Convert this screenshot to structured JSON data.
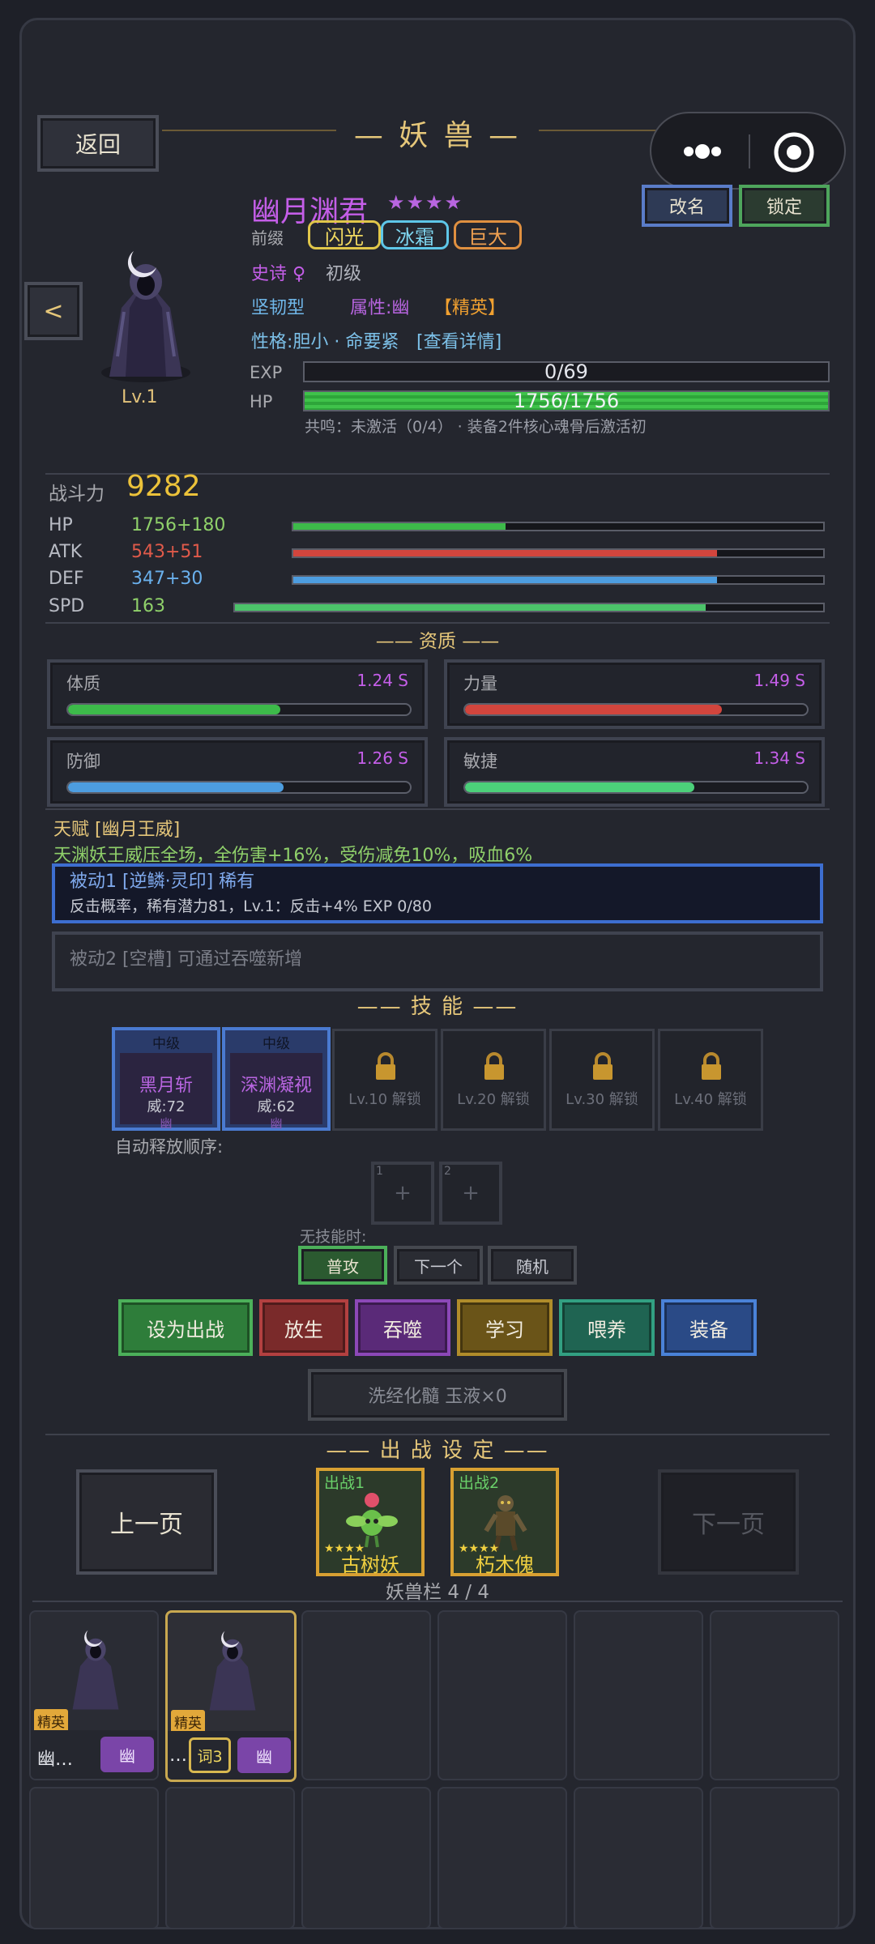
{
  "header": {
    "title": "— 妖 兽 —",
    "back_label": "返回",
    "rename_label": "改名",
    "lock_label": "锁定"
  },
  "monster": {
    "name": "幽月渊君",
    "stars": "★★★★",
    "prefix_label": "前缀",
    "prefixes": [
      "闪光",
      "冰霜",
      "巨大"
    ],
    "rarity": "史诗 ♀",
    "stage": "初级",
    "type": "坚韧型",
    "attribute": "属性:幽",
    "elite_tag": "【精英】",
    "personality": "性格:胆小 · 命要紧",
    "detail_link": "[查看详情]",
    "level": "Lv.1",
    "exp_label": "EXP",
    "exp_value": "0/69",
    "exp_fraction": 0,
    "hp_label": "HP",
    "hp_value": "1756/1756",
    "hp_fraction": 1,
    "resonance": "共鸣：未激活（0/4） · 装备2件核心魂骨后激活初",
    "prev_label": "<"
  },
  "combat": {
    "label": "战斗力",
    "value": "9282"
  },
  "stats": [
    {
      "name": "HP",
      "value": "1756+180",
      "fraction": 0.4,
      "color": "#3dba4a"
    },
    {
      "name": "ATK",
      "value": "543+51",
      "fraction": 0.8,
      "color": "#d2453d"
    },
    {
      "name": "DEF",
      "value": "347+30",
      "fraction": 0.8,
      "color": "#4d9de0"
    },
    {
      "name": "SPD",
      "value": "163",
      "fraction": 0.8,
      "color": "#4cc36a"
    }
  ],
  "aptitude": {
    "title": "—— 资质 ——",
    "items": [
      {
        "name": "体质",
        "grade": "1.24 S",
        "fraction": 0.62,
        "color": "#3dba4a"
      },
      {
        "name": "力量",
        "grade": "1.49 S",
        "fraction": 0.75,
        "color": "#d2453d"
      },
      {
        "name": "防御",
        "grade": "1.26 S",
        "fraction": 0.63,
        "color": "#4d9de0"
      },
      {
        "name": "敏捷",
        "grade": "1.34 S",
        "fraction": 0.67,
        "color": "#4cd07a"
      }
    ]
  },
  "talent": {
    "title": "天赋 [幽月王威]",
    "desc": "天渊妖王威压全场，全伤害+16%，受伤减免10%，吸血6%"
  },
  "passives": [
    {
      "title": "被动1 [逆鳞·灵印] 稀有",
      "desc": "反击概率，稀有潜力81，Lv.1：反击+4%  EXP 0/80"
    },
    {
      "title": "被动2 [空槽] 可通过吞噬新增"
    }
  ],
  "skills": {
    "title": "—— 技 能 ——",
    "learned": [
      {
        "grade": "中级",
        "name": "黑月斩",
        "power": "威:72",
        "element": "幽"
      },
      {
        "grade": "中级",
        "name": "深渊凝视",
        "power": "威:62",
        "element": "幽"
      }
    ],
    "locked": [
      "Lv.10 解锁",
      "Lv.20 解锁",
      "Lv.30 解锁",
      "Lv.40 解锁"
    ],
    "auto_order_label": "自动释放顺序:",
    "order_slots": [
      {
        "num": "1",
        "plus": "+"
      },
      {
        "num": "2",
        "plus": "+"
      }
    ],
    "no_skill_label": "无技能时:",
    "no_skill_options": [
      "普攻",
      "下一个",
      "随机"
    ]
  },
  "actions": [
    {
      "label": "设为出战",
      "color": "#2e7d3a",
      "border": "#4cb05a"
    },
    {
      "label": "放生",
      "color": "#7a2a2a",
      "border": "#b34040"
    },
    {
      "label": "吞噬",
      "color": "#5a2a78",
      "border": "#8c48b8"
    },
    {
      "label": "学习",
      "color": "#6a5418",
      "border": "#b08c2a"
    },
    {
      "label": "喂养",
      "color": "#1f6452",
      "border": "#32a082"
    },
    {
      "label": "装备",
      "color": "#2a4a86",
      "border": "#4a82d8"
    }
  ],
  "wash_label": "洗经化髓  玉液×0",
  "battle": {
    "title": "—— 出 战 设 定 ——",
    "prev_page": "上一页",
    "next_page": "下一页",
    "teams": [
      {
        "slot": "出战1",
        "stars": "★★★★",
        "name": "古树妖"
      },
      {
        "slot": "出战2",
        "stars": "★★★★",
        "name": "朽木傀"
      }
    ],
    "capacity": "妖兽栏 4 / 4"
  },
  "inventory": [
    {
      "badge": "精英",
      "name": "幽…",
      "element": "幽"
    },
    {
      "badge": "精英",
      "name": "…",
      "tag": "词3",
      "element": "幽"
    }
  ],
  "capsule": {
    "more_icon": "more-icon",
    "close_icon": "target-icon"
  }
}
